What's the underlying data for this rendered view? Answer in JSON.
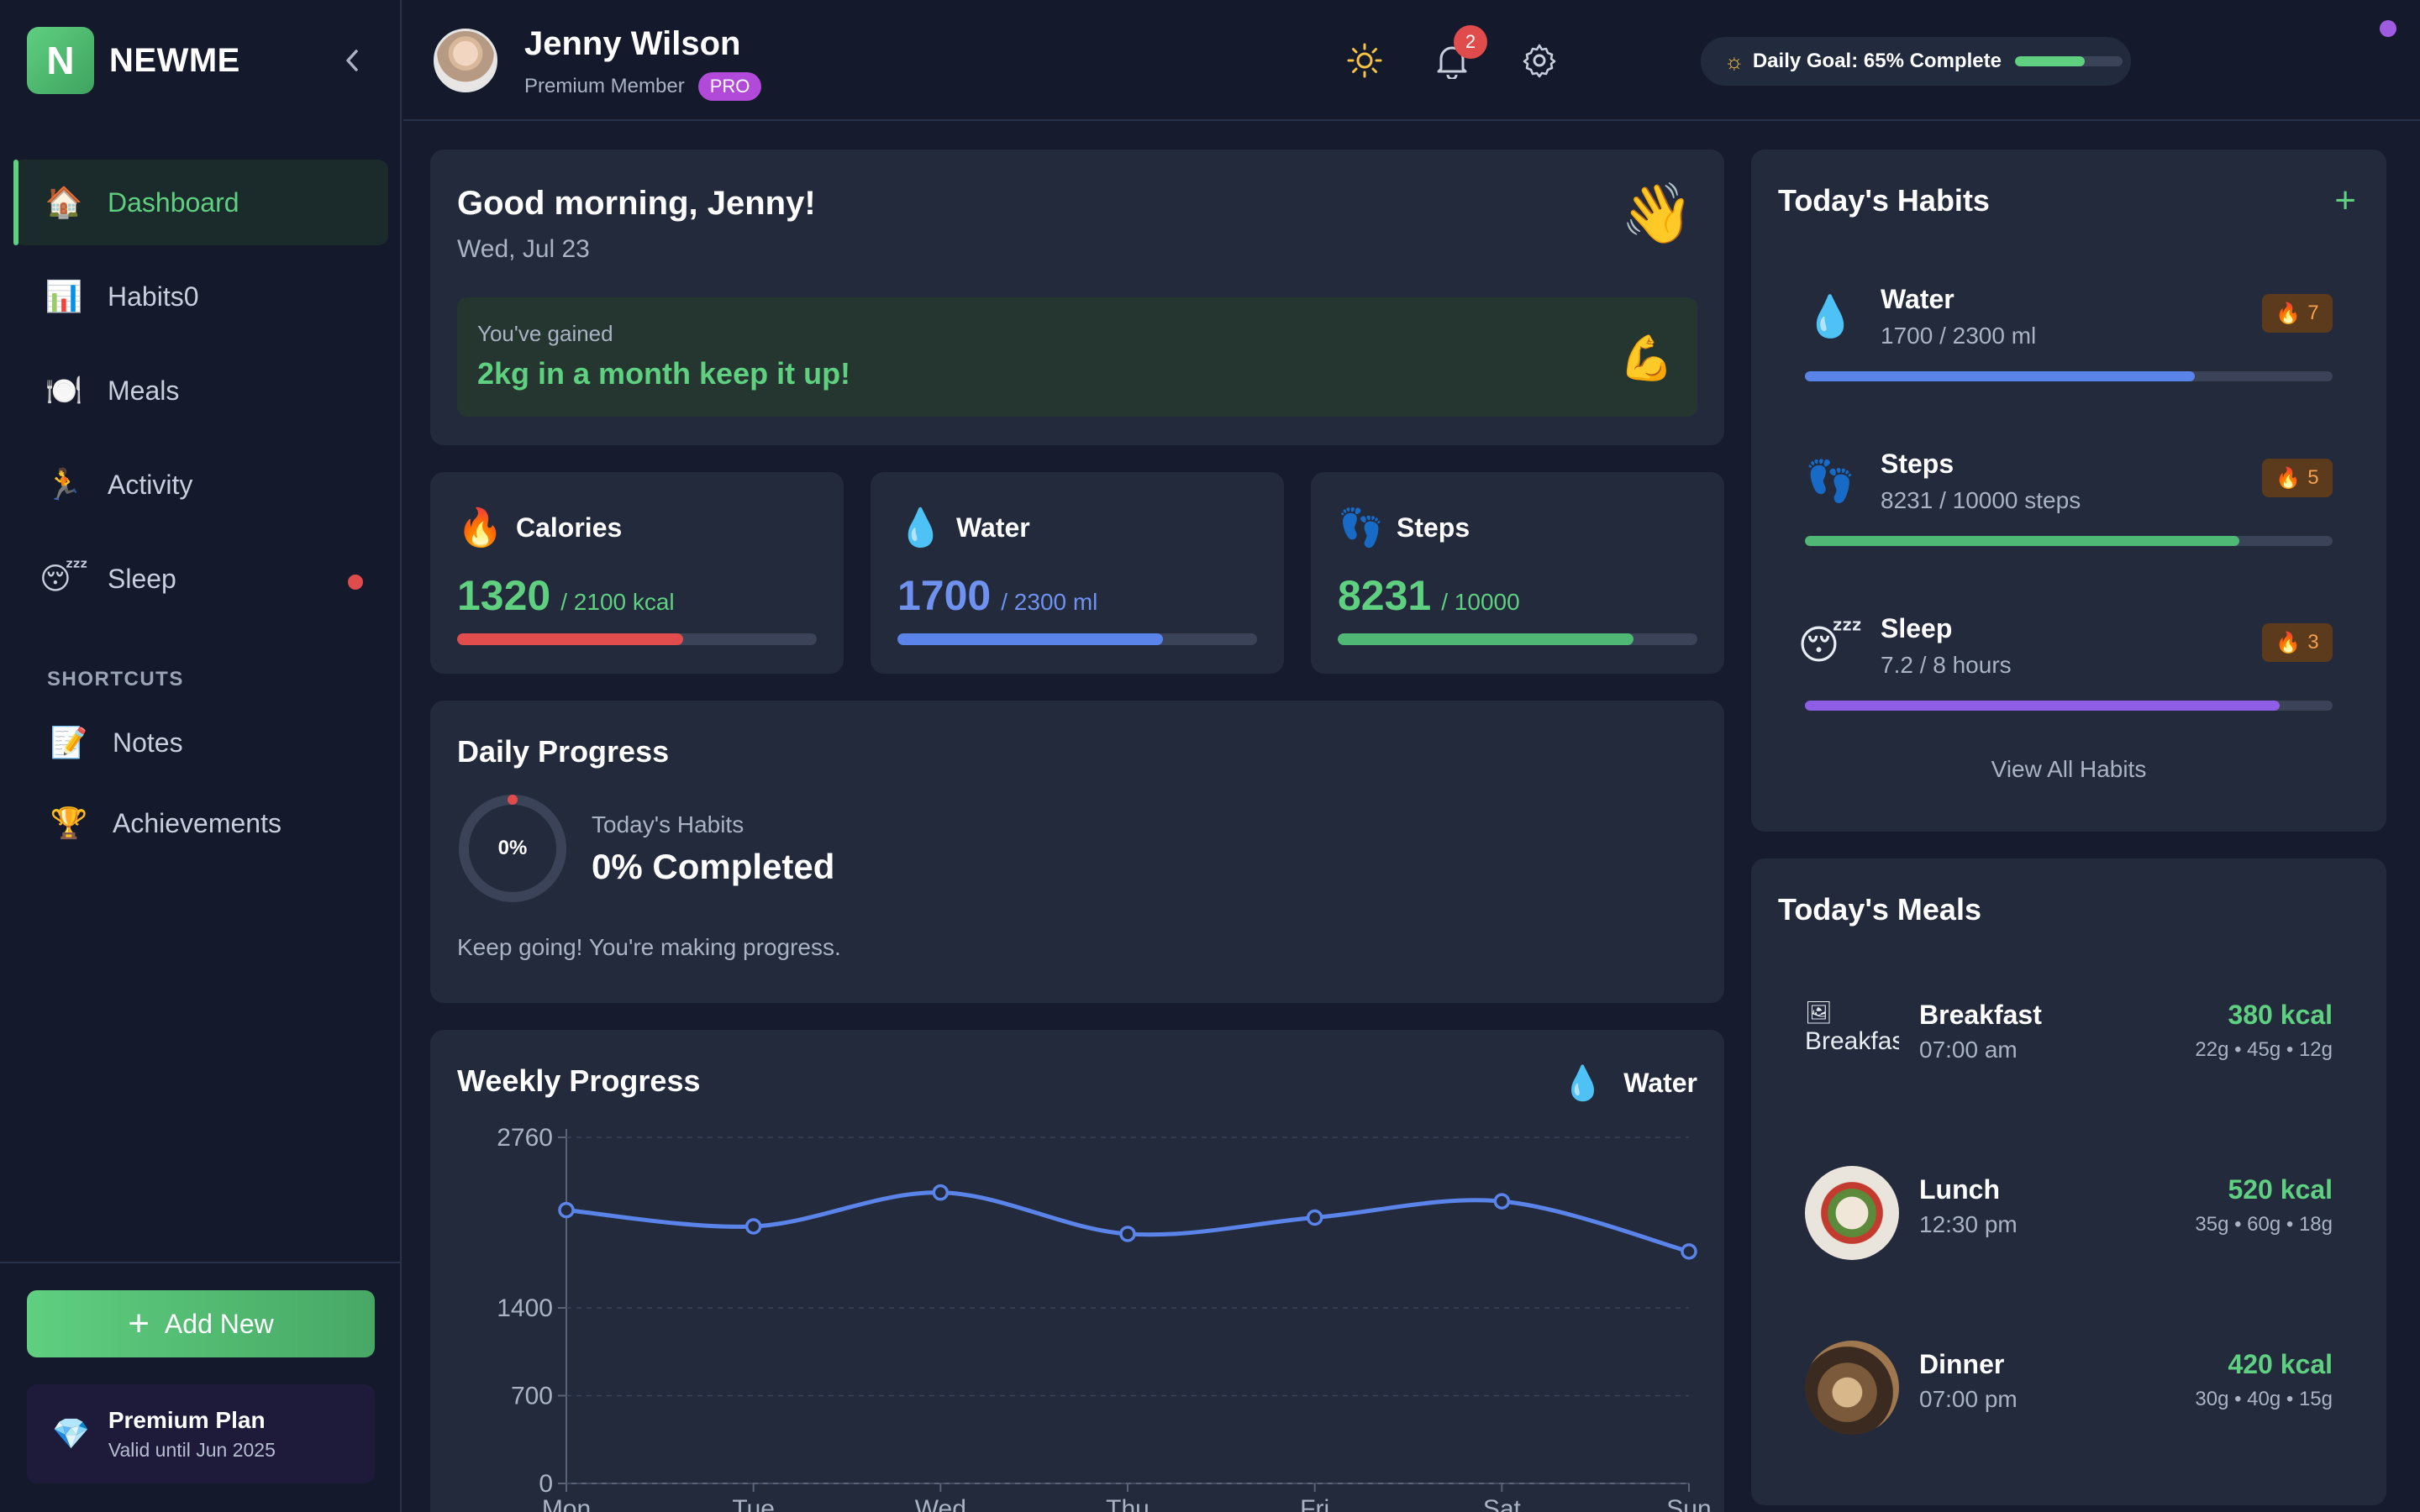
{
  "brand": {
    "logo_letter": "N",
    "name": "NEWME"
  },
  "sidebar": {
    "items": [
      {
        "label": "Dashboard",
        "icon": "🏠",
        "icon_name": "home-icon",
        "active": true
      },
      {
        "label": "Habits0",
        "icon": "📊",
        "icon_name": "chart-icon"
      },
      {
        "label": "Meals",
        "icon": "🍽️",
        "icon_name": "plate-icon"
      },
      {
        "label": "Activity",
        "icon": "🏃",
        "icon_name": "runner-icon"
      },
      {
        "label": "Sleep",
        "icon": "😴",
        "icon_name": "sleep-icon",
        "dot": true
      }
    ],
    "shortcuts_label": "SHORTCUTS",
    "shortcuts": [
      {
        "label": "Notes",
        "icon": "📝",
        "icon_name": "notes-icon"
      },
      {
        "label": "Achievements",
        "icon": "🏆",
        "icon_name": "trophy-icon"
      }
    ],
    "add_new": "Add New",
    "premium": {
      "title": "Premium Plan",
      "subtitle": "Valid until Jun 2025",
      "icon": "💎"
    }
  },
  "topbar": {
    "user_name": "Jenny Wilson",
    "user_role": "Premium Member",
    "badge": "PRO",
    "daily_goal": "Daily Goal: 65% Complete",
    "daily_goal_progress": 0.65,
    "notifications": "2"
  },
  "greeting": {
    "title": "Good morning, Jenny!",
    "date": "Wed, Jul 23",
    "wave": "👋",
    "gain_sub": "You've gained",
    "gain_main": "2kg in a month keep it up!",
    "muscle": "💪"
  },
  "stats": [
    {
      "title": "Calories",
      "icon": "🔥",
      "value": "1320",
      "unit": "/ 2100 kcal",
      "progress": 0.629,
      "color": "#e14c4c",
      "value_color": "#5ed080",
      "unit_color": "#5ed080"
    },
    {
      "title": "Water",
      "icon": "💧",
      "value": "1700",
      "unit": "/ 2300 ml",
      "progress": 0.739,
      "color": "#5b84ea",
      "value_color": "#6f92f0",
      "unit_color": "#6f92f0"
    },
    {
      "title": "Steps",
      "icon": "👣",
      "value": "8231",
      "unit": "/ 10000",
      "progress": 0.823,
      "color": "#4fb874",
      "value_color": "#5ed080",
      "unit_color": "#5ed080"
    }
  ],
  "daily_progress": {
    "title": "Daily Progress",
    "ring_label": "0%",
    "sub": "Today's Habits",
    "main": "0% Completed",
    "note": "Keep going! You're making progress."
  },
  "weekly_progress": {
    "title": "Weekly Progress",
    "legend": "Water",
    "legend_icon": "💧"
  },
  "chart_data": {
    "type": "line",
    "title": "Weekly Progress",
    "categories": [
      "Mon",
      "Tue",
      "Wed",
      "Thu",
      "Fri",
      "Sat",
      "Sun"
    ],
    "series": [
      {
        "name": "Water",
        "values": [
          2180,
          2050,
          2320,
          1990,
          2120,
          2250,
          1850
        ]
      }
    ],
    "y_ticks": [
      "0",
      "700",
      "1400",
      "2760"
    ],
    "ylim": [
      0,
      2760
    ],
    "grid": true,
    "color": "#5b84ea"
  },
  "habits": {
    "title": "Today's Habits",
    "add": "+",
    "items": [
      {
        "name": "Water",
        "sub": "1700 / 2300 ml",
        "streak": "7",
        "icon": "💧",
        "progress": 0.739,
        "color": "#5b84ea"
      },
      {
        "name": "Steps",
        "sub": "8231 / 10000 steps",
        "streak": "5",
        "icon": "👣",
        "progress": 0.823,
        "color": "#4fb874"
      },
      {
        "name": "Sleep",
        "sub": "7.2 / 8 hours",
        "streak": "3",
        "icon": "😴",
        "progress": 0.9,
        "color": "#8f5ee6"
      }
    ],
    "view_all": "View All Habits"
  },
  "meals": {
    "title": "Today's Meals",
    "items": [
      {
        "name": "Breakfast",
        "time": "07:00 am",
        "kcal": "380 kcal",
        "macros": "22g • 45g • 12g",
        "alt": "Breakfast"
      },
      {
        "name": "Lunch",
        "time": "12:30 pm",
        "kcal": "520 kcal",
        "macros": "35g • 60g • 18g"
      },
      {
        "name": "Dinner",
        "time": "07:00 pm",
        "kcal": "420 kcal",
        "macros": "30g • 40g • 15g"
      }
    ]
  }
}
